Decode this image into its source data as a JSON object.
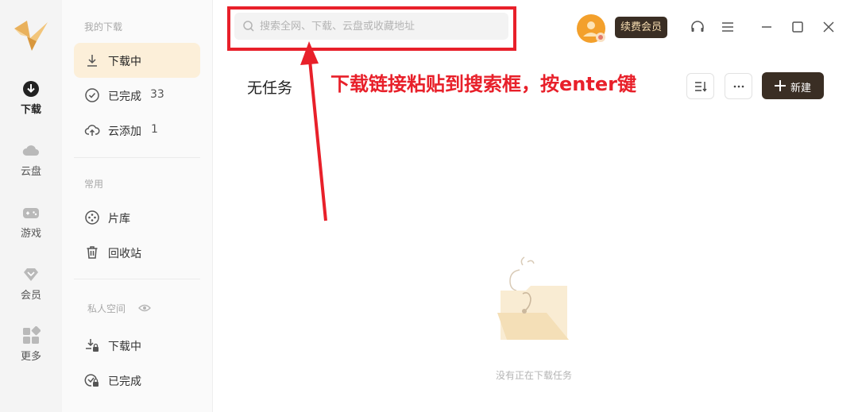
{
  "rail": {
    "items": [
      {
        "label": "下载",
        "icon": "download-circle-icon",
        "active": true
      },
      {
        "label": "云盘",
        "icon": "cloud-icon"
      },
      {
        "label": "游戏",
        "icon": "gamepad-icon"
      },
      {
        "label": "会员",
        "icon": "diamond-icon"
      },
      {
        "label": "更多",
        "icon": "grid-icon"
      }
    ]
  },
  "sidebar": {
    "section_downloads": "我的下载",
    "downloading": {
      "label": "下载中",
      "icon": "download-arrow-icon",
      "active": true
    },
    "completed": {
      "label": "已完成",
      "count": "33",
      "icon": "check-circle-icon"
    },
    "cloud_added": {
      "label": "云添加",
      "count": "1",
      "icon": "cloud-upload-icon"
    },
    "section_common": "常用",
    "library": {
      "label": "片库",
      "icon": "film-reel-icon"
    },
    "recycle": {
      "label": "回收站",
      "icon": "trash-icon"
    },
    "section_private": "私人空间",
    "private_downloading": {
      "label": "下载中",
      "icon": "lock-download-icon"
    },
    "private_completed": {
      "label": "已完成",
      "icon": "lock-check-icon"
    }
  },
  "search": {
    "placeholder": "搜索全网、下载、云盘或收藏地址"
  },
  "header": {
    "vip_label": "续费会员"
  },
  "main": {
    "title": "无任务",
    "new_label": "新建",
    "empty_text": "没有正在下载任务"
  },
  "annotation": {
    "text": "下载链接粘贴到搜索框，按enter键",
    "color": "#e8202a"
  },
  "colors": {
    "accent": "#3a2e24",
    "active_bg": "#fcefd9",
    "avatar": "#f3a02c"
  }
}
